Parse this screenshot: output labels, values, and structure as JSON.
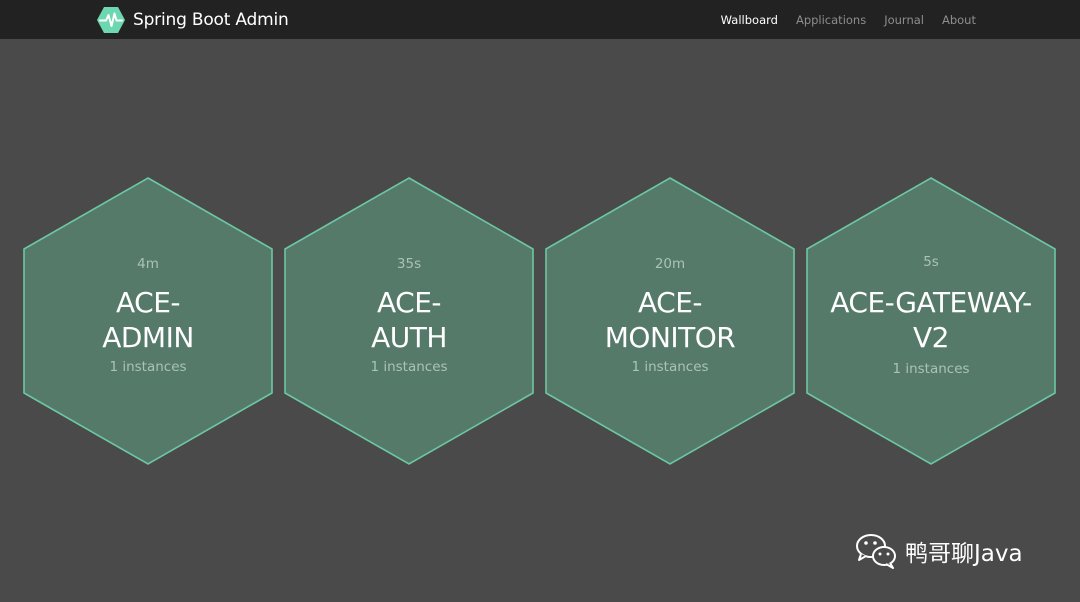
{
  "header": {
    "brand": "Spring Boot Admin",
    "nav": [
      "Wallboard",
      "Applications",
      "Journal",
      "About"
    ],
    "active_nav": "Wallboard"
  },
  "applications": [
    {
      "time": "4m",
      "name_lines": [
        "ACE-",
        "ADMIN"
      ],
      "instances": "1 instances",
      "status": "UP"
    },
    {
      "time": "35s",
      "name_lines": [
        "ACE-",
        "AUTH"
      ],
      "instances": "1 instances",
      "status": "UP"
    },
    {
      "time": "20m",
      "name_lines": [
        "ACE-",
        "MONITOR"
      ],
      "instances": "1 instances",
      "status": "UP"
    },
    {
      "time": "5s",
      "name_lines": [
        "ACE-GATEWAY-",
        "V2"
      ],
      "instances": "1 instances",
      "status": "UP"
    }
  ],
  "watermark": {
    "text": "鸭哥聊Java"
  },
  "colors": {
    "background": "#4a4a4a",
    "navbar": "#222222",
    "hex_fill": "#567a6a",
    "hex_stroke": "#6cc7a4",
    "brand_logo": "#6cd7b0"
  },
  "icons": {
    "brand": "spring-boot-admin-heartbeat-icon",
    "watermark": "wechat-icon"
  }
}
